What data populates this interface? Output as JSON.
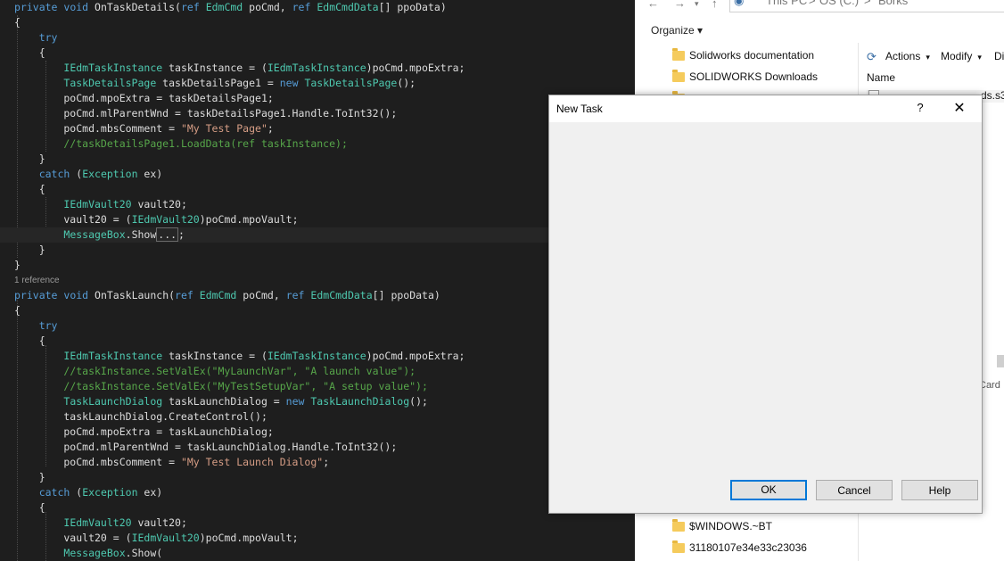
{
  "editor": {
    "lines": [
      [
        [
          "kw",
          "private"
        ],
        [
          "t",
          " "
        ],
        [
          "kw",
          "void"
        ],
        [
          "t",
          " OnTaskDetails("
        ],
        [
          "kw",
          "ref"
        ],
        [
          "t",
          " "
        ],
        [
          "ty",
          "EdmCmd"
        ],
        [
          "t",
          " poCmd, "
        ],
        [
          "kw",
          "ref"
        ],
        [
          "t",
          " "
        ],
        [
          "ty",
          "EdmCmdData"
        ],
        [
          "t",
          "[] ppoData)"
        ]
      ],
      [
        [
          "t",
          "{"
        ]
      ],
      [
        [
          "t",
          "    "
        ],
        [
          "kw",
          "try"
        ]
      ],
      [
        [
          "t",
          "    {"
        ]
      ],
      [
        [
          "t",
          "        "
        ],
        [
          "ty",
          "IEdmTaskInstance"
        ],
        [
          "t",
          " taskInstance = ("
        ],
        [
          "ty",
          "IEdmTaskInstance"
        ],
        [
          "t",
          ")poCmd.mpoExtra;"
        ]
      ],
      [
        [
          "t",
          "        "
        ],
        [
          "ty",
          "TaskDetailsPage"
        ],
        [
          "t",
          " taskDetailsPage1 = "
        ],
        [
          "kw",
          "new"
        ],
        [
          "t",
          " "
        ],
        [
          "ty",
          "TaskDetailsPage"
        ],
        [
          "t",
          "();"
        ]
      ],
      [
        [
          "t",
          "        poCmd.mpoExtra = taskDetailsPage1;"
        ]
      ],
      [
        [
          "t",
          "        poCmd.mlParentWnd = taskDetailsPage1.Handle.ToInt32();"
        ]
      ],
      [
        [
          "t",
          "        poCmd.mbsComment = "
        ],
        [
          "st",
          "\"My Test Page\""
        ],
        [
          "t",
          ";"
        ]
      ],
      [
        [
          "t",
          "        "
        ],
        [
          "cm",
          "//taskDetailsPage1.LoadData(ref taskInstance);"
        ]
      ],
      [
        [
          "t",
          "    }"
        ]
      ],
      [
        [
          "t",
          "    "
        ],
        [
          "kw",
          "catch"
        ],
        [
          "t",
          " ("
        ],
        [
          "ty",
          "Exception"
        ],
        [
          "t",
          " ex)"
        ]
      ],
      [
        [
          "t",
          "    {"
        ]
      ],
      [
        [
          "t",
          "        "
        ],
        [
          "ty",
          "IEdmVault20"
        ],
        [
          "t",
          " vault20;"
        ]
      ],
      [
        [
          "t",
          "        vault20 = ("
        ],
        [
          "ty",
          "IEdmVault20"
        ],
        [
          "t",
          ")poCmd.mpoVault;"
        ]
      ],
      [
        [
          "t",
          "        "
        ],
        [
          "ty",
          "MessageBox"
        ],
        [
          "t",
          ".Show"
        ],
        [
          "fold",
          "..."
        ],
        [
          "t",
          ";"
        ]
      ],
      [
        [
          "t",
          "    }"
        ]
      ],
      [
        [
          "t",
          "}"
        ]
      ],
      [
        [
          "ref",
          "1 reference"
        ]
      ],
      [
        [
          "kw",
          "private"
        ],
        [
          "t",
          " "
        ],
        [
          "kw",
          "void"
        ],
        [
          "t",
          " OnTaskLaunch("
        ],
        [
          "kw",
          "ref"
        ],
        [
          "t",
          " "
        ],
        [
          "ty",
          "EdmCmd"
        ],
        [
          "t",
          " poCmd, "
        ],
        [
          "kw",
          "ref"
        ],
        [
          "t",
          " "
        ],
        [
          "ty",
          "EdmCmdData"
        ],
        [
          "t",
          "[] ppoData)"
        ]
      ],
      [
        [
          "t",
          "{"
        ]
      ],
      [
        [
          "t",
          "    "
        ],
        [
          "kw",
          "try"
        ]
      ],
      [
        [
          "t",
          "    {"
        ]
      ],
      [
        [
          "t",
          "        "
        ],
        [
          "ty",
          "IEdmTaskInstance"
        ],
        [
          "t",
          " taskInstance = ("
        ],
        [
          "ty",
          "IEdmTaskInstance"
        ],
        [
          "t",
          ")poCmd.mpoExtra;"
        ]
      ],
      [
        [
          "t",
          "        "
        ],
        [
          "cm",
          "//taskInstance.SetValEx(\"MyLaunchVar\", \"A launch value\");"
        ]
      ],
      [
        [
          "t",
          "        "
        ],
        [
          "cm",
          "//taskInstance.SetValEx(\"MyTestSetupVar\", \"A setup value\");"
        ]
      ],
      [
        [
          "t",
          "        "
        ],
        [
          "ty",
          "TaskLaunchDialog"
        ],
        [
          "t",
          " taskLaunchDialog = "
        ],
        [
          "kw",
          "new"
        ],
        [
          "t",
          " "
        ],
        [
          "ty",
          "TaskLaunchDialog"
        ],
        [
          "t",
          "();"
        ]
      ],
      [
        [
          "t",
          "        taskLaunchDialog.CreateControl();"
        ]
      ],
      [
        [
          "t",
          "        poCmd.mpoExtra = taskLaunchDialog;"
        ]
      ],
      [
        [
          "t",
          "        poCmd.mlParentWnd = taskLaunchDialog.Handle.ToInt32();"
        ]
      ],
      [
        [
          "t",
          "        poCmd.mbsComment = "
        ],
        [
          "st",
          "\"My Test Launch Dialog\""
        ],
        [
          "t",
          ";"
        ]
      ],
      [
        [
          "t",
          "    }"
        ]
      ],
      [
        [
          "t",
          "    "
        ],
        [
          "kw",
          "catch"
        ],
        [
          "t",
          " ("
        ],
        [
          "ty",
          "Exception"
        ],
        [
          "t",
          " ex)"
        ]
      ],
      [
        [
          "t",
          "    {"
        ]
      ],
      [
        [
          "t",
          "        "
        ],
        [
          "ty",
          "IEdmVault20"
        ],
        [
          "t",
          " vault20;"
        ]
      ],
      [
        [
          "t",
          "        vault20 = ("
        ],
        [
          "ty",
          "IEdmVault20"
        ],
        [
          "t",
          ")poCmd.mpoVault;"
        ]
      ],
      [
        [
          "t",
          "        "
        ],
        [
          "ty",
          "MessageBox"
        ],
        [
          "t",
          ".Show("
        ]
      ]
    ]
  },
  "explorer": {
    "breadcrumb": [
      "This PC",
      ">",
      "OS (C:)",
      ">",
      "Borks"
    ],
    "organize_label": "Organize ▾",
    "folders_top": [
      "Solidworks documentation",
      "SOLIDWORKS Downloads"
    ],
    "folders_bottom": [
      "$WINDOWS.~BT",
      "31180107e34e33c23036"
    ],
    "actions_label": "Actions",
    "modify_label": "Modify",
    "di_label": "Di",
    "name_header": "Name",
    "partial_file": "ds.s3",
    "card_label": "Card"
  },
  "dialog": {
    "title": "New Task",
    "help_glyph": "?",
    "close_glyph": "✕",
    "ok_label": "OK",
    "cancel_label": "Cancel",
    "help_label": "Help"
  },
  "colors": {
    "editor_bg": "#1e1e1e",
    "keyword": "#569cd6",
    "type": "#4ec9b0",
    "string": "#d69d85",
    "comment": "#57a64a",
    "accent": "#0078d7"
  }
}
